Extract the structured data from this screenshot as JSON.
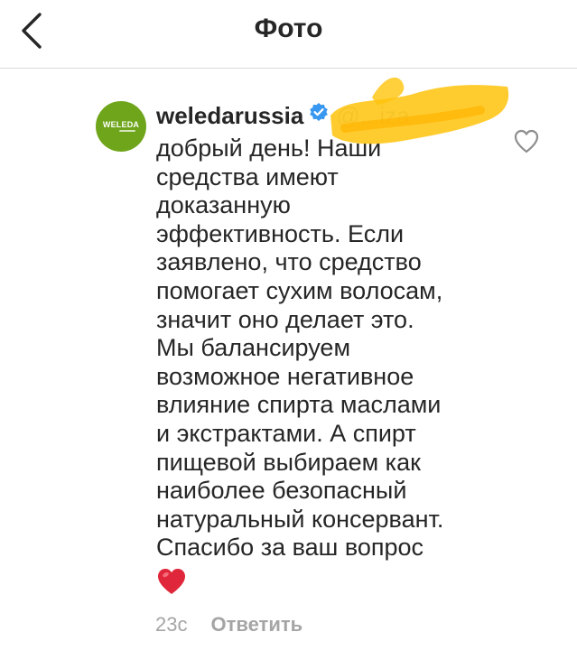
{
  "header": {
    "title": "Фото",
    "back_icon": "chevron-left-icon"
  },
  "comment": {
    "avatar_label": "WELEDA",
    "avatar_color": "#6fa51b",
    "username": "weledarussia",
    "verified_icon": "verified-badge-icon",
    "verified_color": "#3897f0",
    "mention": "@...iza",
    "lines": [
      "добрый день! Наши",
      "средства имеют",
      "доказанную",
      "эффективность. Если",
      "заявлено, что средство",
      "помогает сухим волосам,",
      "значит оно делает это.",
      "Мы балансируем",
      "возможное негативное",
      "влияние спирта маслами",
      "и экстрактами. А спирт",
      "пищевой выбираем как",
      "наиболее безопасный",
      "натуральный консервант.",
      "Спасибо за ваш вопрос"
    ],
    "emoji": "heart-emoji",
    "timestamp": "23с",
    "reply_label": "Ответить",
    "like_icon": "heart-outline-icon"
  },
  "redaction_color": "#ffc30b"
}
